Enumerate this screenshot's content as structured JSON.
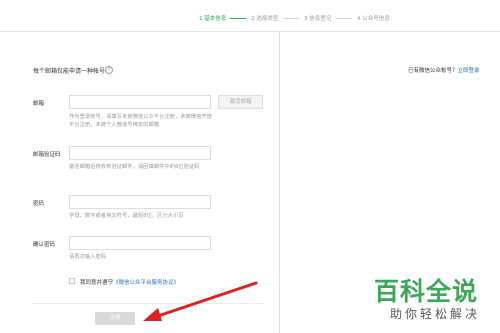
{
  "steps": [
    {
      "label": "1 基本信息",
      "active": true
    },
    {
      "label": "2 选择类型",
      "active": false
    },
    {
      "label": "3 信息登记",
      "active": false
    },
    {
      "label": "4 公众号信息",
      "active": false
    }
  ],
  "section_title": "每个邮箱仅能申请一种帐号",
  "has_account": {
    "text": "已有微信公众帐号？",
    "link": "立即登录"
  },
  "form": {
    "email": {
      "label": "邮箱",
      "value": "",
      "button": "激活邮箱",
      "hint": "作为登录帐号，请填写未被微信公众平台注册，未被微信开放平台注册，未被个人微信号绑定的邮箱"
    },
    "verify_code": {
      "label": "邮箱验证码",
      "value": "",
      "hint": "激活邮箱后将收到验证邮件，请回填邮件中的6位验证码"
    },
    "password": {
      "label": "密码",
      "value": "",
      "hint": "字母、数字或者英文符号，最短8位，区分大小写"
    },
    "confirm_password": {
      "label": "确认密码",
      "value": "",
      "hint": "请再次输入密码"
    },
    "agreement": {
      "text": "我同意并遵守",
      "link": "《微信公众平台服务协议》",
      "checked": false
    },
    "register_button": "注册"
  },
  "watermark": {
    "main": "百科全说",
    "sub": "助你轻松解决"
  },
  "colors": {
    "accent": "#3aa857",
    "link": "#2e6fb7",
    "arrow": "#e02020"
  }
}
